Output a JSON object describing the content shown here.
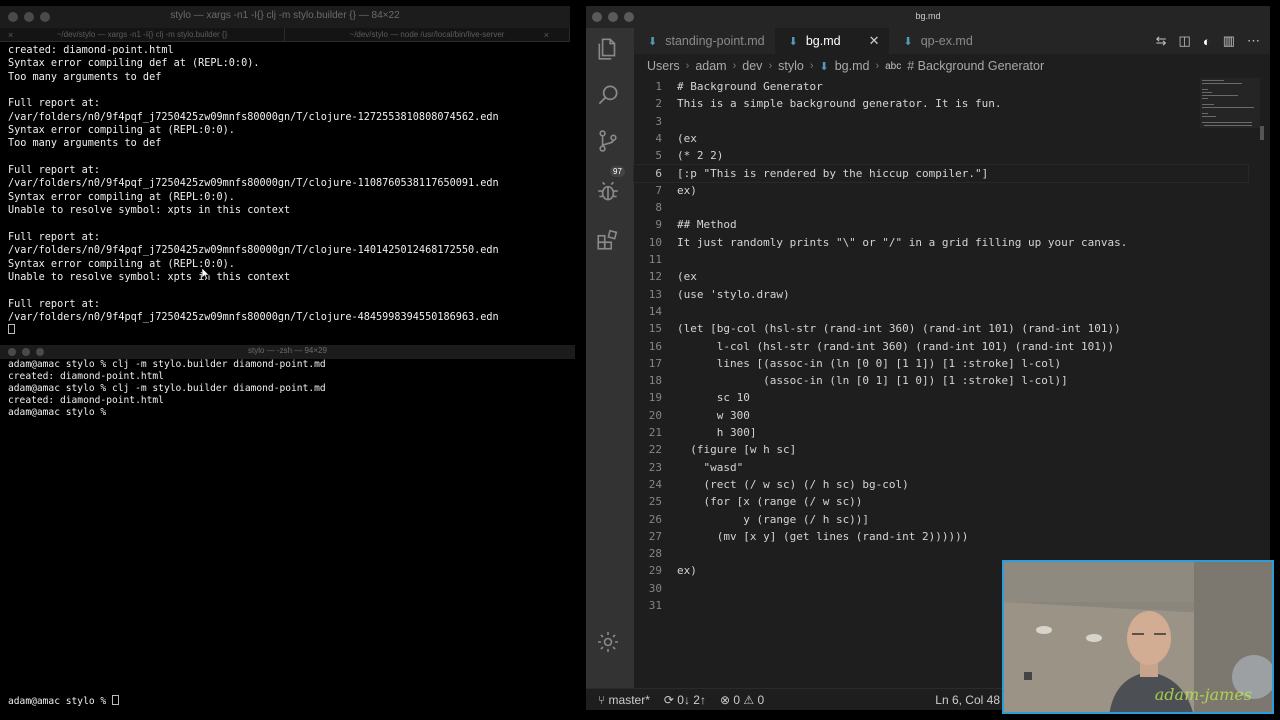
{
  "terminal_top": {
    "title": "stylo — xargs -n1 -I{} clj -m stylo.builder {} — 84×22",
    "tabs": [
      {
        "label": "~/dev/stylo — xargs -n1 -I{} clj -m stylo.builder {}"
      },
      {
        "label": "~/dev/stylo — node /usr/local/bin/live-server"
      }
    ],
    "lines": [
      "created: diamond-point.html",
      "Syntax error compiling def at (REPL:0:0).",
      "Too many arguments to def",
      "",
      "Full report at:",
      "/var/folders/n0/9f4pqf_j7250425zw09mnfs80000gn/T/clojure-1272553810808074562.edn",
      "Syntax error compiling at (REPL:0:0).",
      "Too many arguments to def",
      "",
      "Full report at:",
      "/var/folders/n0/9f4pqf_j7250425zw09mnfs80000gn/T/clojure-1108760538117650091.edn",
      "Syntax error compiling at (REPL:0:0).",
      "Unable to resolve symbol: xpts in this context",
      "",
      "Full report at:",
      "/var/folders/n0/9f4pqf_j7250425zw09mnfs80000gn/T/clojure-1401425012468172550.edn",
      "Syntax error compiling at (REPL:0:0).",
      "Unable to resolve symbol: xpts in this context",
      "",
      "Full report at:",
      "/var/folders/n0/9f4pqf_j7250425zw09mnfs80000gn/T/clojure-4845998394550186963.edn"
    ]
  },
  "terminal_bottom": {
    "title": "stylo — -zsh — 94×29",
    "lines": [
      "adam@amac stylo % clj -m stylo.builder diamond-point.md",
      "created: diamond-point.html",
      "adam@amac stylo % clj -m stylo.builder diamond-point.md",
      "created: diamond-point.html",
      "adam@amac stylo % "
    ],
    "prompt_line": "adam@amac stylo % "
  },
  "vscode": {
    "window_title": "bg.md",
    "tabs": [
      {
        "label": "standing-point.md",
        "active": false
      },
      {
        "label": "bg.md",
        "active": true
      },
      {
        "label": "qp-ex.md",
        "active": false
      }
    ],
    "breadcrumb": [
      "Users",
      "adam",
      "dev",
      "stylo",
      "bg.md",
      "# Background Generator"
    ],
    "breadcrumb_symbol": "abc",
    "scm_badge": "97",
    "active_line": 6,
    "lines": [
      {
        "n": "1",
        "text": "# Background Generator",
        "heading": true
      },
      {
        "n": "2",
        "text": "This is a simple background generator. It is fun."
      },
      {
        "n": "3",
        "text": ""
      },
      {
        "n": "4",
        "text": "(ex"
      },
      {
        "n": "5",
        "text": "(* 2 2)"
      },
      {
        "n": "6",
        "text": "[:p \"This is rendered by the hiccup compiler.\"]"
      },
      {
        "n": "7",
        "text": "ex)"
      },
      {
        "n": "8",
        "text": ""
      },
      {
        "n": "9",
        "text": "## Method",
        "heading": true
      },
      {
        "n": "10",
        "text": "It just randomly prints \"\\\" or \"/\" in a grid filling up your canvas."
      },
      {
        "n": "11",
        "text": ""
      },
      {
        "n": "12",
        "text": "(ex"
      },
      {
        "n": "13",
        "text": "(use 'stylo.draw)"
      },
      {
        "n": "14",
        "text": ""
      },
      {
        "n": "15",
        "text": "(let [bg-col (hsl-str (rand-int 360) (rand-int 101) (rand-int 101))"
      },
      {
        "n": "16",
        "text": "      l-col (hsl-str (rand-int 360) (rand-int 101) (rand-int 101))"
      },
      {
        "n": "17",
        "text": "      lines [(assoc-in (ln [0 0] [1 1]) [1 :stroke] l-col)"
      },
      {
        "n": "18",
        "text": "             (assoc-in (ln [0 1] [1 0]) [1 :stroke] l-col)]"
      },
      {
        "n": "19",
        "text": "      sc 10"
      },
      {
        "n": "20",
        "text": "      w 300"
      },
      {
        "n": "21",
        "text": "      h 300]"
      },
      {
        "n": "22",
        "text": "  (figure [w h sc]"
      },
      {
        "n": "23",
        "text": "    \"wasd\""
      },
      {
        "n": "24",
        "text": "    (rect (/ w sc) (/ h sc) bg-col)"
      },
      {
        "n": "25",
        "text": "    (for [x (range (/ w sc))"
      },
      {
        "n": "26",
        "text": "          y (range (/ h sc))]"
      },
      {
        "n": "27",
        "text": "      (mv [x y] (get lines (rand-int 2))))))"
      },
      {
        "n": "28",
        "text": ""
      },
      {
        "n": "29",
        "text": "ex)"
      },
      {
        "n": "30",
        "text": ""
      },
      {
        "n": "31",
        "text": ""
      }
    ],
    "status": {
      "branch": "master*",
      "sync": "0↓ 2↑",
      "errors": "0",
      "warnings": "0",
      "position": "Ln 6, Col 48"
    }
  },
  "webcam": {
    "watermark": "adam-james"
  },
  "colors": {
    "terminal_bg": "#000000",
    "editor_bg": "#1e1e1e",
    "heading": "#569cd6",
    "accent_border": "#2d9cdb"
  }
}
